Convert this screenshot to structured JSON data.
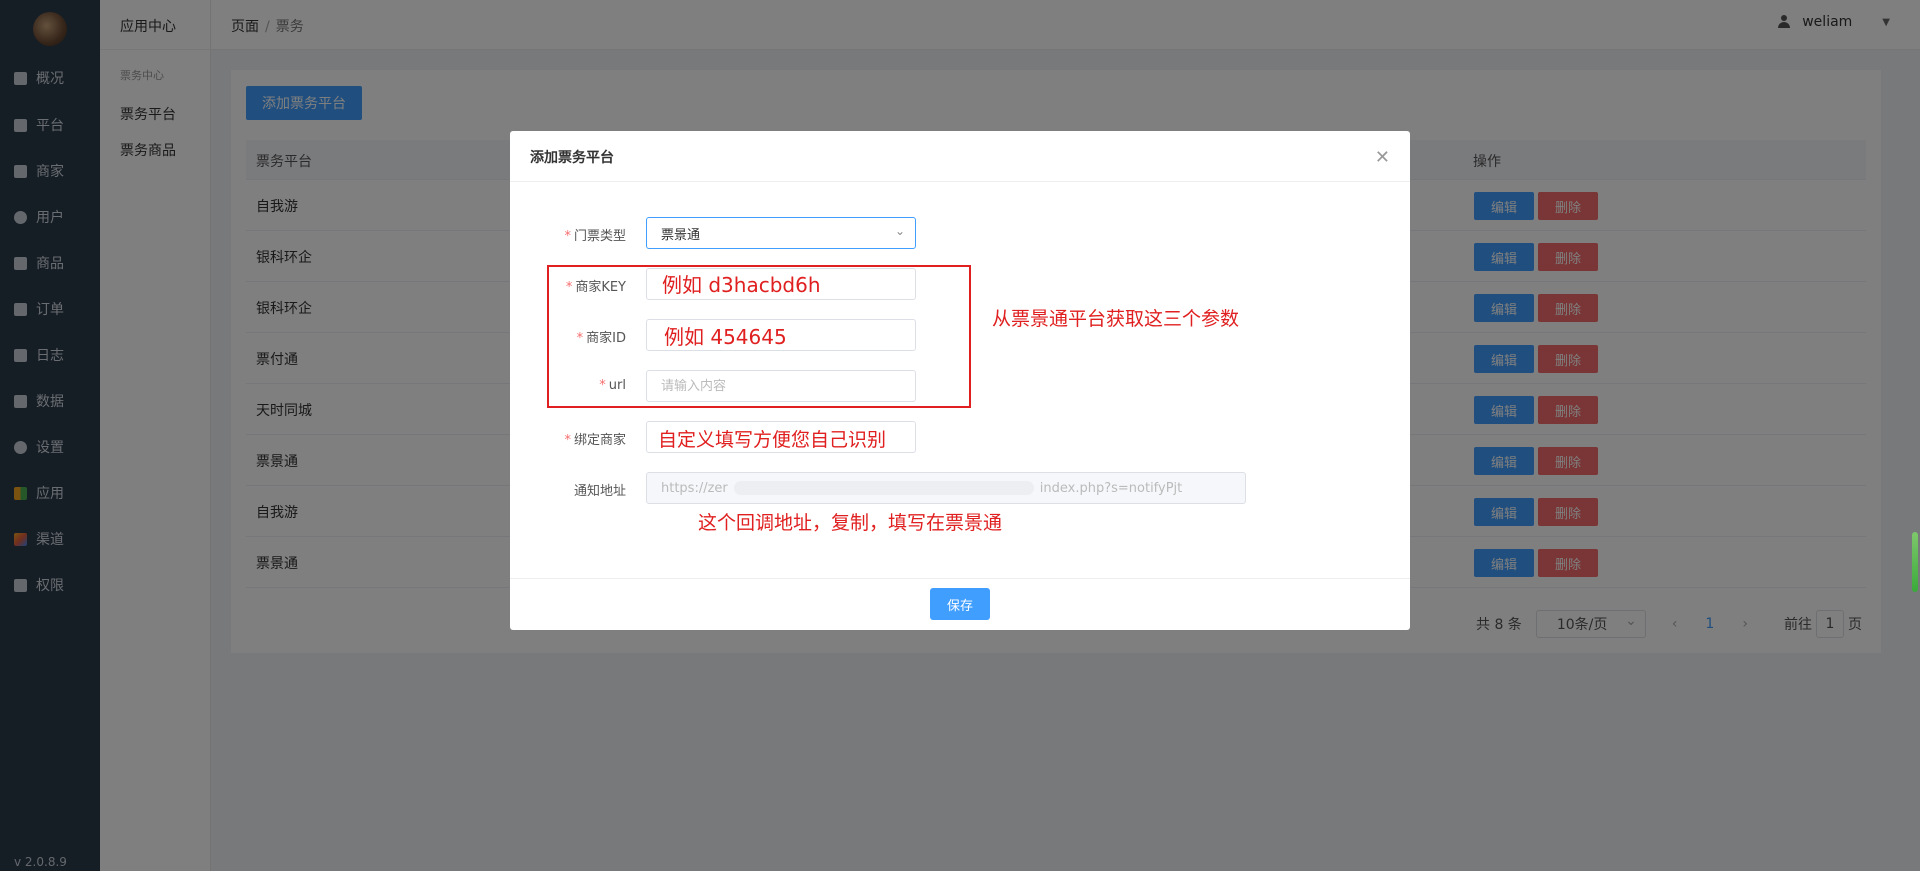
{
  "sidebar": {
    "items": [
      {
        "label": "概况",
        "icon": "dashboard-icon"
      },
      {
        "label": "平台",
        "icon": "monitor-icon"
      },
      {
        "label": "商家",
        "icon": "store-icon"
      },
      {
        "label": "用户",
        "icon": "user-icon"
      },
      {
        "label": "商品",
        "icon": "goods-icon"
      },
      {
        "label": "订单",
        "icon": "order-icon"
      },
      {
        "label": "日志",
        "icon": "log-icon"
      },
      {
        "label": "数据",
        "icon": "chart-icon"
      },
      {
        "label": "设置",
        "icon": "gear-icon"
      },
      {
        "label": "应用",
        "icon": "apps-icon"
      },
      {
        "label": "渠道",
        "icon": "cube-icon"
      },
      {
        "label": "权限",
        "icon": "lock-icon"
      }
    ],
    "version": "v 2.0.8.9"
  },
  "subsidebar": {
    "title": "应用中心",
    "group": "票务中心",
    "links": [
      "票务平台",
      "票务商品"
    ]
  },
  "header": {
    "breadcrumb": [
      "页面",
      "票务"
    ],
    "username": "weliam"
  },
  "main": {
    "add_button": "添加票务平台",
    "columns": [
      "票务平台",
      "操作"
    ],
    "rows": [
      "自我游",
      "银科环企",
      "银科环企",
      "票付通",
      "天时同城",
      "票景通",
      "自我游",
      "票景通"
    ],
    "edit_label": "编辑",
    "delete_label": "删除",
    "pagination": {
      "total": "共 8 条",
      "page_size": "10条/页",
      "current_page": "1",
      "goto_prefix": "前往",
      "goto_value": "1",
      "goto_suffix": "页"
    }
  },
  "dialog": {
    "title": "添加票务平台",
    "fields": {
      "ticket_type": {
        "label": "门票类型",
        "value": "票景通"
      },
      "merchant_key": {
        "label": "商家KEY",
        "annotation": "例如 d3hacbd6h"
      },
      "merchant_id": {
        "label": "商家ID",
        "annotation": "例如 454645"
      },
      "url": {
        "label": "url",
        "placeholder": "请输入内容"
      },
      "bind_merchant": {
        "label": "绑定商家",
        "annotation": "自定义填写方便您自己识别"
      },
      "notify_url": {
        "label": "通知地址",
        "value_start": "https://zer",
        "value_end": "index.php?s=notifyPjt"
      }
    },
    "save_label": "保存"
  },
  "annotations": {
    "params_note": "从票景通平台获取这三个参数",
    "callback_note": "这个回调地址，复制，填写在票景通"
  },
  "colors": {
    "sidebar_bg": "#2b3a4a",
    "primary": "#409eff",
    "danger": "#f56c6c",
    "annotation_red": "#e02020"
  }
}
